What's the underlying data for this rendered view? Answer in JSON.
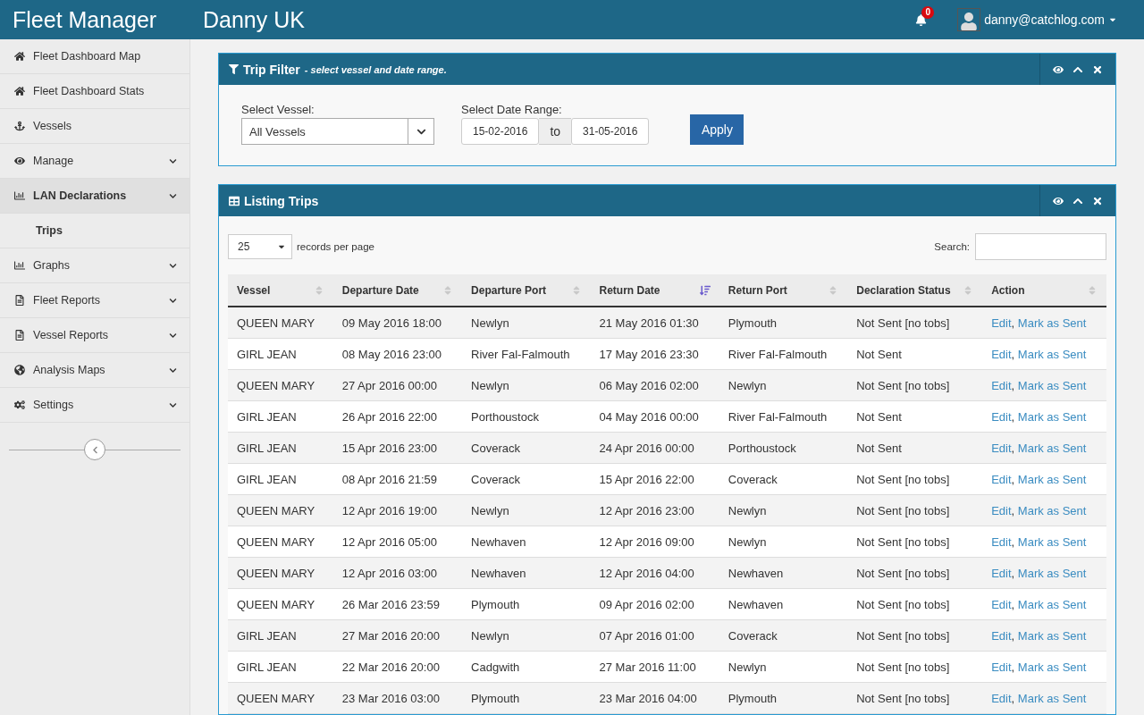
{
  "header": {
    "app_title": "Fleet Manager",
    "org_name": "Danny UK",
    "notifications": "0",
    "user": "danny@catchlog.com"
  },
  "sidebar": {
    "items": [
      {
        "label": "Fleet Dashboard Map",
        "kind": "link"
      },
      {
        "label": "Fleet Dashboard Stats",
        "kind": "link"
      },
      {
        "label": "Vessels",
        "kind": "link"
      },
      {
        "label": "Manage",
        "kind": "menu",
        "expanded": false
      },
      {
        "label": "LAN Declarations",
        "kind": "menu",
        "expanded": true,
        "children": [
          {
            "label": "Trips"
          }
        ]
      },
      {
        "label": "Graphs",
        "kind": "menu",
        "expanded": false
      },
      {
        "label": "Fleet Reports",
        "kind": "menu",
        "expanded": false
      },
      {
        "label": "Vessel Reports",
        "kind": "menu",
        "expanded": false
      },
      {
        "label": "Analysis Maps",
        "kind": "menu",
        "expanded": false
      },
      {
        "label": "Settings",
        "kind": "menu",
        "expanded": false
      }
    ]
  },
  "trip_filter": {
    "title": "Trip Filter",
    "subtitle": "- select vessel and date range.",
    "vessel_label": "Select Vessel:",
    "vessel_value": "All Vessels",
    "date_label": "Select Date Range:",
    "date_from": "15-02-2016",
    "date_separator": "to",
    "date_to": "31-05-2016",
    "apply": "Apply"
  },
  "listing": {
    "title": "Listing Trips",
    "page_size": "25",
    "page_size_label": "records per page",
    "search_label": "Search:",
    "columns": [
      {
        "label": "Vessel",
        "sorted": false
      },
      {
        "label": "Departure Date",
        "sorted": false
      },
      {
        "label": "Departure Port",
        "sorted": false
      },
      {
        "label": "Return Date",
        "sorted": true
      },
      {
        "label": "Return Port",
        "sorted": false
      },
      {
        "label": "Declaration Status",
        "sorted": false
      },
      {
        "label": "Action",
        "sorted": false
      }
    ],
    "action_separator": ",",
    "rows": [
      {
        "cells": [
          "QUEEN MARY",
          "09 May 2016 18:00",
          "Newlyn",
          "21 May 2016 01:30",
          "Plymouth",
          "Not Sent [no tobs]"
        ],
        "actions": [
          "Edit",
          "Mark as Sent"
        ]
      },
      {
        "cells": [
          "GIRL JEAN",
          "08 May 2016 23:00",
          "River Fal-Falmouth",
          "17 May 2016 23:30",
          "River Fal-Falmouth",
          "Not Sent"
        ],
        "actions": [
          "Edit",
          "Mark as Sent"
        ]
      },
      {
        "cells": [
          "QUEEN MARY",
          "27 Apr 2016 00:00",
          "Newlyn",
          "06 May 2016 02:00",
          "Newlyn",
          "Not Sent [no tobs]"
        ],
        "actions": [
          "Edit",
          "Mark as Sent"
        ]
      },
      {
        "cells": [
          "GIRL JEAN",
          "26 Apr 2016 22:00",
          "Porthoustock",
          "04 May 2016 00:00",
          "River Fal-Falmouth",
          "Not Sent"
        ],
        "actions": [
          "Edit",
          "Mark as Sent"
        ]
      },
      {
        "cells": [
          "GIRL JEAN",
          "15 Apr 2016 23:00",
          "Coverack",
          "24 Apr 2016 00:00",
          "Porthoustock",
          "Not Sent"
        ],
        "actions": [
          "Edit",
          "Mark as Sent"
        ]
      },
      {
        "cells": [
          "GIRL JEAN",
          "08 Apr 2016 21:59",
          "Coverack",
          "15 Apr 2016 22:00",
          "Coverack",
          "Not Sent [no tobs]"
        ],
        "actions": [
          "Edit",
          "Mark as Sent"
        ]
      },
      {
        "cells": [
          "QUEEN MARY",
          "12 Apr 2016 19:00",
          "Newlyn",
          "12 Apr 2016 23:00",
          "Newlyn",
          "Not Sent [no tobs]"
        ],
        "actions": [
          "Edit",
          "Mark as Sent"
        ]
      },
      {
        "cells": [
          "QUEEN MARY",
          "12 Apr 2016 05:00",
          "Newhaven",
          "12 Apr 2016 09:00",
          "Newlyn",
          "Not Sent [no tobs]"
        ],
        "actions": [
          "Edit",
          "Mark as Sent"
        ]
      },
      {
        "cells": [
          "QUEEN MARY",
          "12 Apr 2016 03:00",
          "Newhaven",
          "12 Apr 2016 04:00",
          "Newhaven",
          "Not Sent [no tobs]"
        ],
        "actions": [
          "Edit",
          "Mark as Sent"
        ]
      },
      {
        "cells": [
          "QUEEN MARY",
          "26 Mar 2016 23:59",
          "Plymouth",
          "09 Apr 2016 02:00",
          "Newhaven",
          "Not Sent [no tobs]"
        ],
        "actions": [
          "Edit",
          "Mark as Sent"
        ]
      },
      {
        "cells": [
          "GIRL JEAN",
          "27 Mar 2016 20:00",
          "Newlyn",
          "07 Apr 2016 01:00",
          "Coverack",
          "Not Sent [no tobs]"
        ],
        "actions": [
          "Edit",
          "Mark as Sent"
        ]
      },
      {
        "cells": [
          "GIRL JEAN",
          "22 Mar 2016 20:00",
          "Cadgwith",
          "27 Mar 2016 11:00",
          "Newlyn",
          "Not Sent [no tobs]"
        ],
        "actions": [
          "Edit",
          "Mark as Sent"
        ]
      },
      {
        "cells": [
          "QUEEN MARY",
          "23 Mar 2016 03:00",
          "Plymouth",
          "23 Mar 2016 04:00",
          "Plymouth",
          "Not Sent [no tobs]"
        ],
        "actions": [
          "Edit",
          "Mark as Sent"
        ]
      }
    ]
  }
}
